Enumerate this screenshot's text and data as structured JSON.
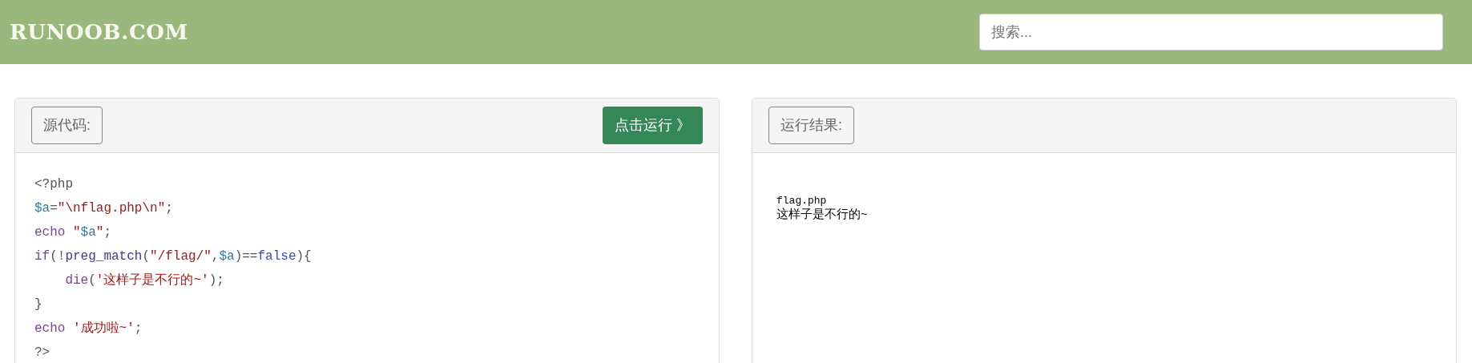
{
  "header": {
    "logo": "RUNOOB.COM",
    "search": {
      "placeholder": "搜索..."
    }
  },
  "source_panel": {
    "label": "源代码:",
    "run_button": "点击运行 》",
    "code_lines": [
      [
        {
          "kind": "plain",
          "text": "<?php"
        }
      ],
      [
        {
          "kind": "variable",
          "text": "$a"
        },
        {
          "kind": "plain",
          "text": "="
        },
        {
          "kind": "string",
          "text": "\"\\nflag.php\\n\""
        },
        {
          "kind": "plain",
          "text": ";"
        }
      ],
      [
        {
          "kind": "keyword",
          "text": "echo"
        },
        {
          "kind": "string",
          "text": "\"",
          "space_before": true
        },
        {
          "kind": "variable",
          "text": "$a"
        },
        {
          "kind": "string",
          "text": "\""
        },
        {
          "kind": "plain",
          "text": ";"
        }
      ],
      [
        {
          "kind": "keyword",
          "text": "if"
        },
        {
          "kind": "plain",
          "text": "(!"
        },
        {
          "kind": "builtin",
          "text": "preg_match"
        },
        {
          "kind": "plain",
          "text": "("
        },
        {
          "kind": "string",
          "text": "\"/flag/\""
        },
        {
          "kind": "plain",
          "text": ","
        },
        {
          "kind": "variable",
          "text": "$a"
        },
        {
          "kind": "plain",
          "text": ")=="
        },
        {
          "kind": "atom",
          "text": "false"
        },
        {
          "kind": "plain",
          "text": "){"
        }
      ],
      [
        {
          "kind": "keyword",
          "text": "die",
          "indent": true
        },
        {
          "kind": "plain",
          "text": "("
        },
        {
          "kind": "string",
          "text": "'这样子是不行的~'"
        },
        {
          "kind": "plain",
          "text": ");"
        }
      ],
      [
        {
          "kind": "plain",
          "text": "}"
        }
      ],
      [
        {
          "kind": "keyword",
          "text": "echo"
        },
        {
          "kind": "string",
          "text": "'成功啦~'",
          "space_before": true
        },
        {
          "kind": "plain",
          "text": ";"
        }
      ],
      [
        {
          "kind": "plain",
          "text": "?>"
        }
      ]
    ]
  },
  "result_panel": {
    "label": "运行结果:",
    "output_lines": [
      {
        "kind": "mono",
        "text": "flag.php"
      },
      {
        "kind": "text",
        "text": "这样子是不行的~"
      }
    ]
  }
}
